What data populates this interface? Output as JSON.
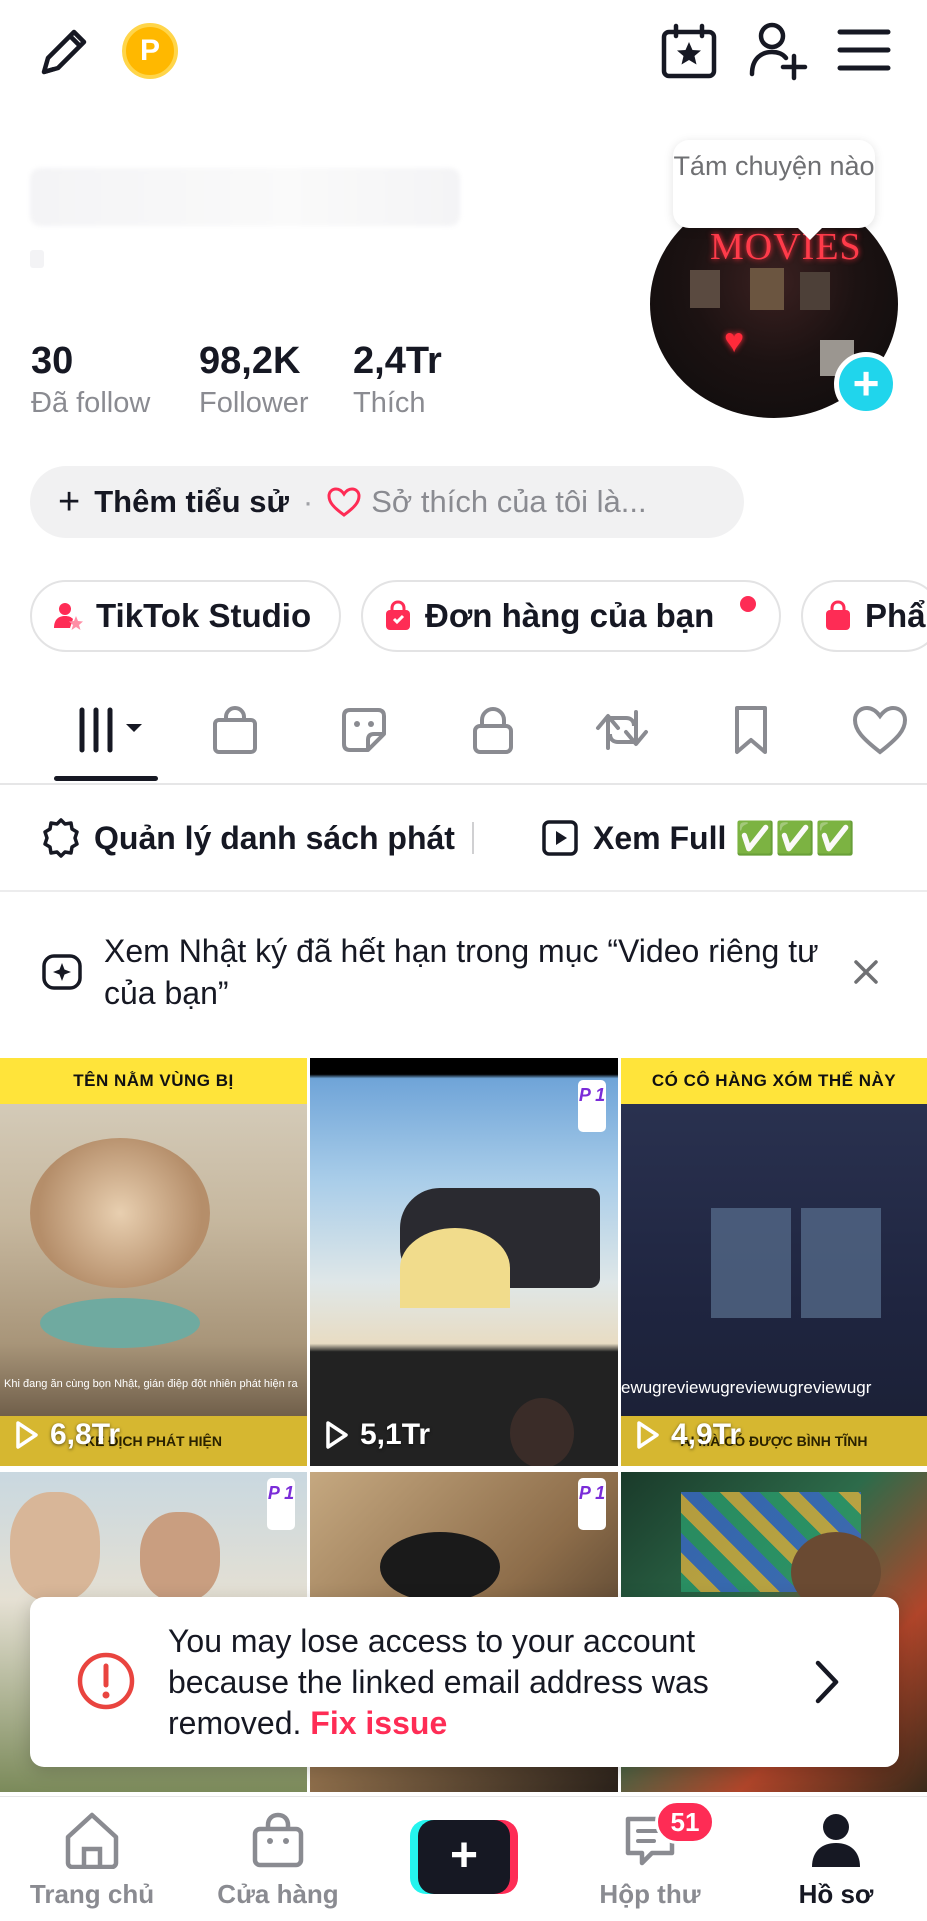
{
  "profile": {
    "tooltip": "Tám chuyện nào",
    "avatar_neon_text": "MOVIES",
    "stats": [
      {
        "value": "30",
        "label": "Đã follow"
      },
      {
        "value": "98,2K",
        "label": "Follower"
      },
      {
        "value": "2,4Tr",
        "label": "Thích"
      }
    ],
    "bio_add": "Thêm tiểu sử",
    "bio_separator": "·",
    "bio_hint": "Sở thích của tôi là..."
  },
  "chips": [
    {
      "label": "TikTok Studio",
      "icon": "person-star-icon"
    },
    {
      "label": "Đơn hàng của bạn",
      "icon": "shopping-bag-icon"
    },
    {
      "label": "Phẩ",
      "icon": "shopping-bag-icon"
    }
  ],
  "playlists": {
    "manage": "Quản lý danh sách phát",
    "full": "Xem Full ✅✅✅"
  },
  "notice": {
    "text": "Xem Nhật ký đã hết hạn trong mục “Video riêng tư của bạn”"
  },
  "videos": [
    {
      "views": "6,8Tr",
      "top_text": "TÊN NẰM VÙNG BỊ",
      "bottom_text": "KẺ ĐỊCH PHÁT HIỆN",
      "subtitle": "Khi đang ăn cùng bọn Nhật, gián điệp đột nhiên phát hiện ra"
    },
    {
      "views": "5,1Tr",
      "badge": "P 1"
    },
    {
      "views": "4,9Tr",
      "top_text": "CÓ CÔ HÀNG XÓM THẾ NÀY",
      "bottom_text": "AI MÀ CÓ ĐƯỢC BÌNH TĨNH",
      "watermark": "ewugreviewugreviewugreviewugr"
    },
    {
      "badge": "P 1"
    },
    {
      "badge": "P 1"
    },
    {}
  ],
  "toast": {
    "message": "You may lose access to your account because the linked email address was removed.",
    "action": "Fix issue"
  },
  "bottom_nav": [
    {
      "label": "Trang chủ",
      "icon": "home-icon"
    },
    {
      "label": "Cửa hàng",
      "icon": "shop-bag-icon"
    },
    {
      "label": "Hộp thư",
      "icon": "inbox-icon",
      "badge": "51"
    },
    {
      "label": "Hồ sơ",
      "icon": "profile-icon",
      "active": true
    }
  ],
  "colors": {
    "brand_pink": "#FE2C55",
    "brand_cyan": "#25F4EE",
    "coin": "#FFB800",
    "text": "#161823"
  },
  "coin_letter": "P"
}
